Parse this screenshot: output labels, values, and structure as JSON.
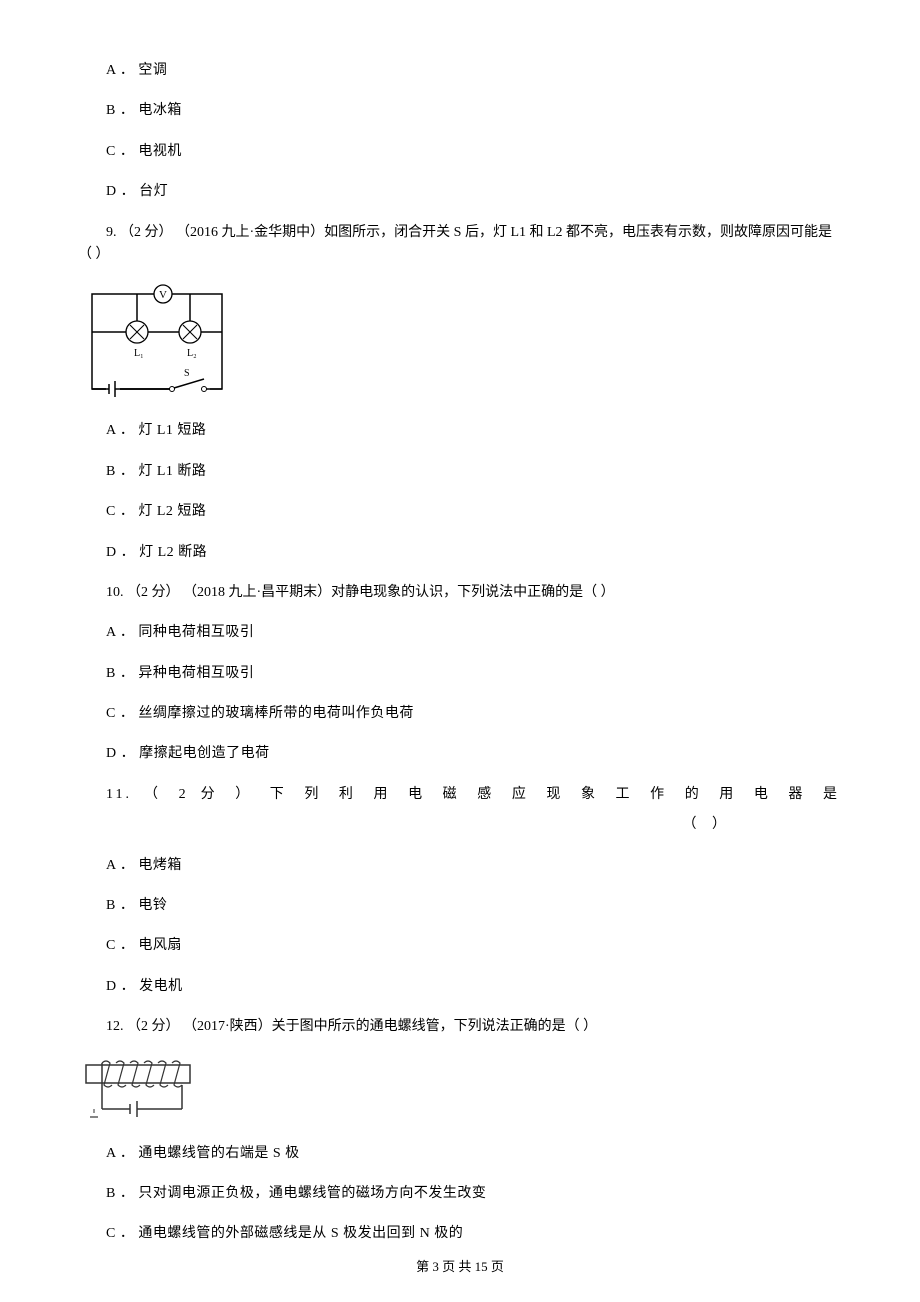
{
  "q8": {
    "a": "A ． 空调",
    "b": "B ． 电冰箱",
    "c": "C ． 电视机",
    "d": "D ． 台灯"
  },
  "q9": {
    "stem": "9.  （2 分） （2016 九上·金华期中）如图所示，闭合开关 S 后，灯 L1 和 L2 都不亮，电压表有示数，则故障原因可能是（     ）",
    "a": "A ． 灯 L1 短路",
    "b": "B ． 灯 L1 断路",
    "c": "C ． 灯 L2 短路",
    "d": "D ． 灯 L2 断路"
  },
  "q10": {
    "stem": "10.  （2 分） （2018 九上·昌平期末）对静电现象的认识，下列说法中正确的是（     ）",
    "a": "A ． 同种电荷相互吸引",
    "b": "B ． 异种电荷相互吸引",
    "c": "C ． 丝绸摩擦过的玻璃棒所带的电荷叫作负电荷",
    "d": "D ． 摩擦起电创造了电荷"
  },
  "q11": {
    "stem": "11. （ 2 分 ）  下 列 利 用 电 磁 感 应 现 象 工 作 的 用 电 器 是",
    "tail": "（   ）",
    "a": "A ． 电烤箱",
    "b": "B ． 电铃",
    "c": "C ． 电风扇",
    "d": "D ． 发电机"
  },
  "q12": {
    "stem": "12.  （2 分） （2017·陕西）关于图中所示的通电螺线管，下列说法正确的是（     ）",
    "a": "A ． 通电螺线管的右端是 S 极",
    "b": "B ． 只对调电源正负极，通电螺线管的磁场方向不发生改变",
    "c": "C ． 通电螺线管的外部磁感线是从 S 极发出回到 N 极的"
  },
  "footer": "第 3 页 共 15 页"
}
